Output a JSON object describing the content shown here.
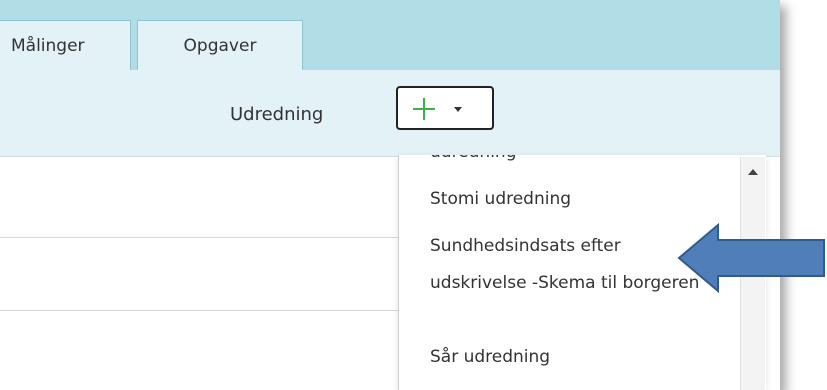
{
  "tabs": [
    {
      "label": "Målinger"
    },
    {
      "label": "Opgaver"
    }
  ],
  "toolbar": {
    "label": "Udredning"
  },
  "add_menu": {
    "button_icons": [
      "plus-icon",
      "caret-down-icon"
    ],
    "items": [
      {
        "label": "udredning"
      },
      {
        "label": "Stomi udredning"
      },
      {
        "label": "Sundhedsindsats efter udskrivelse -Skema til borgeren"
      },
      {
        "label": "Sår udredning"
      }
    ]
  },
  "colors": {
    "tabbar_bg": "#b0dde6",
    "subbar_bg": "#e2f2f6",
    "plus_green": "#3cb34a",
    "arrow_blue": "#4f7eb8"
  }
}
